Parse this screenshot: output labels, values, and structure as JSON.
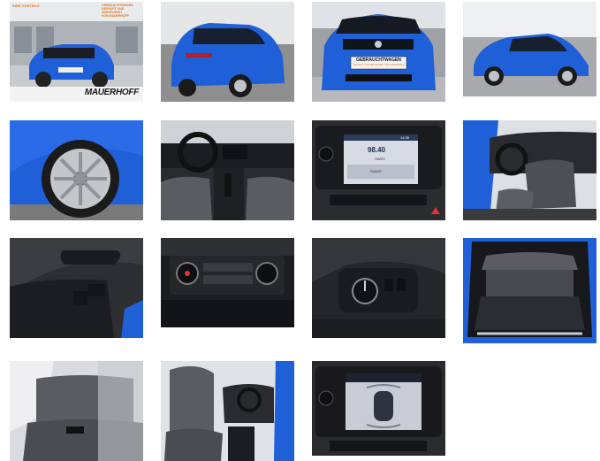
{
  "ad_banner": {
    "headline_left": "IHRE VORTEILE",
    "headline_right": "GEBRAUCHTWAGEN\nGEPRÜFT UND ZERTIFIZIERT\nVON MAUERHOFF",
    "brand": "MAUERHOFF",
    "brand_sub": "AUTOGRUPPE"
  },
  "plate": {
    "line1": "GEBRAUCHTWAGEN",
    "line2": "GEPRÜFT UND ZERTIFIZIERT VON MAUERHOFF"
  },
  "infotainment": {
    "clock": "14:35",
    "station": "98.40",
    "station_label": "SWR3",
    "source": "RADIO",
    "source_sub": "FM/DAB"
  },
  "colors": {
    "car_blue": "#1f5fd8",
    "dark_blue": "#0c2f86",
    "interior_dark": "#1b1c1f",
    "seat_gray": "#5a5c62",
    "ad_orange": "#e8731d",
    "showroom_gray": "#b9bcc1"
  },
  "photos": [
    {
      "id": "ad-exterior",
      "icon": "car-front-ad"
    },
    {
      "id": "rear-three-quarter",
      "icon": "car-rear"
    },
    {
      "id": "front-view",
      "icon": "car-front"
    },
    {
      "id": "side-profile",
      "icon": "car-side"
    },
    {
      "id": "wheel-closeup",
      "icon": "wheel"
    },
    {
      "id": "dashboard",
      "icon": "steering-wheel"
    },
    {
      "id": "infotainment-radio",
      "icon": "screen"
    },
    {
      "id": "driver-seat-door",
      "icon": "seat"
    },
    {
      "id": "window-controls",
      "icon": "switch"
    },
    {
      "id": "climate-controls",
      "icon": "dial"
    },
    {
      "id": "light-switch",
      "icon": "knob"
    },
    {
      "id": "trunk",
      "icon": "trunk"
    },
    {
      "id": "rear-seats",
      "icon": "seat"
    },
    {
      "id": "passenger-seat",
      "icon": "seat"
    },
    {
      "id": "parking-sensor-display",
      "icon": "screen"
    }
  ]
}
